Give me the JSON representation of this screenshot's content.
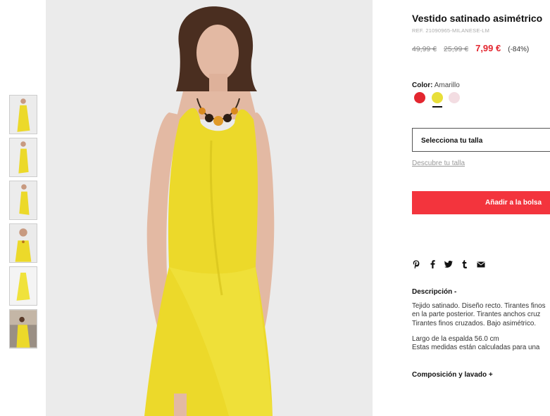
{
  "product": {
    "title": "Vestido satinado asimétrico",
    "ref": "REF. 21090965-MILANESE-LM",
    "price_original": "49,99 €",
    "price_previous": "25,99 €",
    "price_current": "7,99 €",
    "discount": "(-84%)"
  },
  "color": {
    "label": "Color:",
    "value": "Amarillo",
    "swatches": [
      {
        "name": "Rojo",
        "hex": "#e3262f"
      },
      {
        "name": "Amarillo",
        "hex": "#e8df3a",
        "selected": true
      },
      {
        "name": "Rosa",
        "hex": "#f3dde2"
      }
    ]
  },
  "size": {
    "select_label": "Selecciona tu talla",
    "guide_link": "Descubre tu talla"
  },
  "actions": {
    "add_to_bag": "Añadir a la bolsa"
  },
  "share": {
    "icons": [
      "pinterest-icon",
      "facebook-icon",
      "twitter-icon",
      "tumblr-icon",
      "email-icon"
    ]
  },
  "description": {
    "title": "Descripción -",
    "lines": [
      "Tejido satinado. Diseño recto. Tirantes finos",
      "en la parte posterior. Tirantes anchos cruz",
      "Tirantes finos cruzados. Bajo asimétrico."
    ],
    "measure_lines": [
      "Largo de la espalda 56.0 cm",
      "Estas medidas están calculadas para una"
    ]
  },
  "composition": {
    "title": "Composición y lavado +"
  },
  "colors": {
    "accent": "#f3343d",
    "sale_price": "#e3262f",
    "dress_yellow": "#ecd92a"
  }
}
